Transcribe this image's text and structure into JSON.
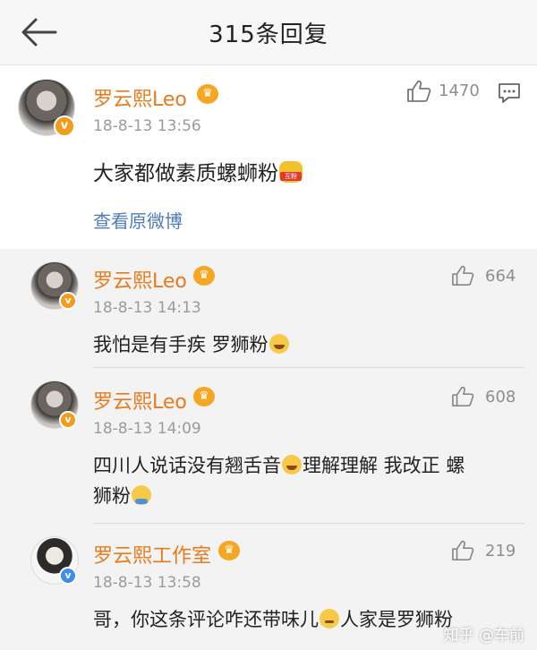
{
  "header": {
    "title": "315条回复"
  },
  "main_comment": {
    "username": "罗云熙Leo",
    "timestamp": "18-8-13 13:56",
    "content": "大家都做素质螺蛳粉",
    "likes": "1470",
    "link": "查看原微博"
  },
  "replies": [
    {
      "username": "罗云熙Leo",
      "timestamp": "18-8-13 14:13",
      "content_parts": [
        "我怕是有手疾 罗狮粉"
      ],
      "likes": "664"
    },
    {
      "username": "罗云熙Leo",
      "timestamp": "18-8-13 14:09",
      "content_parts": [
        "四川人说话没有翘舌音",
        "理解理解 我改正 螺",
        "狮粉"
      ],
      "likes": "608"
    },
    {
      "username": "罗云熙工作室",
      "timestamp": "18-8-13 13:58",
      "content_parts": [
        "哥，你这条评论咋还带味儿",
        "人家是罗狮粉"
      ],
      "likes": "219"
    }
  ],
  "watermark": "知乎 @车前",
  "colors": {
    "username": "#e77b1c",
    "link": "#4f7cb6",
    "badge": "#f39b1a",
    "badge_blue": "#3d8cf0"
  }
}
